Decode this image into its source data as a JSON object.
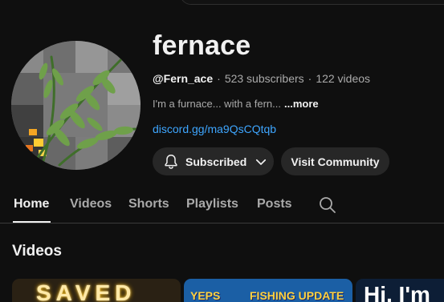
{
  "channel": {
    "name": "fernace",
    "handle": "@Fern_ace",
    "subscribers": "523 subscribers",
    "videos": "122 videos",
    "separator": "·",
    "description": "I'm a furnace... with a fern...",
    "more": "...more",
    "link": "discord.gg/ma9QsCQtqb"
  },
  "buttons": {
    "subscribed": "Subscribed",
    "community": "Visit Community"
  },
  "tabs": [
    {
      "label": "Home",
      "active": true
    },
    {
      "label": "Videos"
    },
    {
      "label": "Shorts"
    },
    {
      "label": "Playlists"
    },
    {
      "label": "Posts"
    }
  ],
  "section": {
    "title": "Videos"
  },
  "thumbnails": [
    {
      "text": "SAVED"
    },
    {
      "text_left": "YEPS",
      "text_right": "FISHING UPDATE"
    },
    {
      "text": "Hi, I'm"
    }
  ],
  "icons": {
    "bell": "bell-icon",
    "chevron": "chevron-down-icon",
    "search": "search-icon"
  },
  "colors": {
    "background": "#0f0f0f",
    "button": "#272727",
    "link": "#3ea6ff",
    "muted_text": "#aaaaaa"
  }
}
